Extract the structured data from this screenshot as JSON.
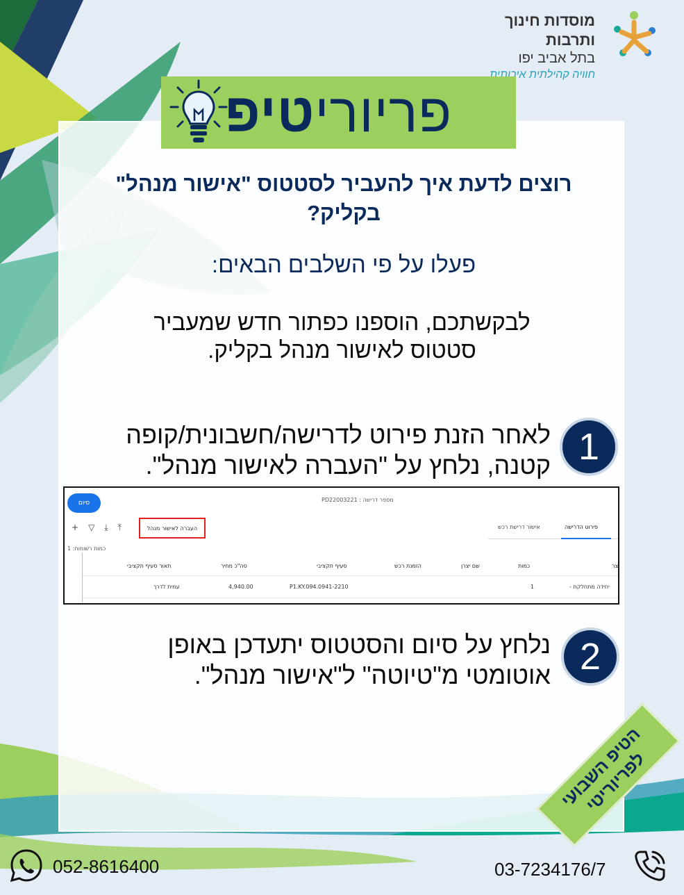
{
  "logo": {
    "line1": "מוסדות חינוך ותרבות",
    "line2": "בתל אביב יפו",
    "line3": "חוויה קהילתית איכותית",
    "icon": "logo-people-icon"
  },
  "banner": {
    "title_light": "פריורי",
    "title_bold": "טיפ",
    "icon": "lightbulb-icon"
  },
  "heading": {
    "line1": "רוצים לדעת איך להעביר לסטטוס \"אישור מנהל\"",
    "line2": "בקליק?"
  },
  "subheading": "פעלו על פי השלבים הבאים:",
  "intro": {
    "line1": "לבקשתכם, הוספנו כפתור חדש שמעביר",
    "line2": "סטטוס לאישור מנהל בקליק."
  },
  "steps": [
    {
      "number": "1",
      "line1": "לאחר הזנת פירוט לדרישה/חשבונית/קופה",
      "line2": "קטנה, נלחץ על \"העברה לאישור מנהל\"."
    },
    {
      "number": "2",
      "line1": "נלחץ על סיום והסטטוס יתעדכן באופן",
      "line2": "אוטומטי מ\"טיוטה\" ל\"אישור מנהל\"."
    }
  ],
  "screenshot": {
    "finish_button": "סיום",
    "request_number": "מספר דרישה : PD22003221",
    "move_button": "העברה לאישור מנהל",
    "toolbar_icons": [
      "plus-icon",
      "filter-icon",
      "download-icon",
      "upload-icon"
    ],
    "tabs": [
      "פירוט הדרישה",
      "אישור דרישת רכש"
    ],
    "record_count": "כמות רשומות: 1",
    "columns": [
      "צר",
      "כמות",
      "שם יצרן",
      "הזמנת רכש",
      "סעיף תקציבי",
      "סה\"כ מחיר",
      "תאור סעיף תקציבי"
    ],
    "row": [
      "יחידה מתחלקת -",
      "1",
      "",
      "",
      "P1.KY.094.0941-2210",
      "4,940.00",
      "עמית לדרך"
    ]
  },
  "sticker": {
    "line1": "הטיפ השבועי",
    "line2": "לפריוריטי"
  },
  "footer": {
    "mobile": "052-8616400",
    "office": "03-7234176/7",
    "whatsapp_icon": "whatsapp-icon",
    "phone_icon": "phone-icon"
  },
  "colors": {
    "navy": "#0b2a5c",
    "green": "#9ccf5e",
    "teal": "#1aa89a",
    "highlight_red": "#e02020",
    "button_blue": "#1a73e8"
  }
}
